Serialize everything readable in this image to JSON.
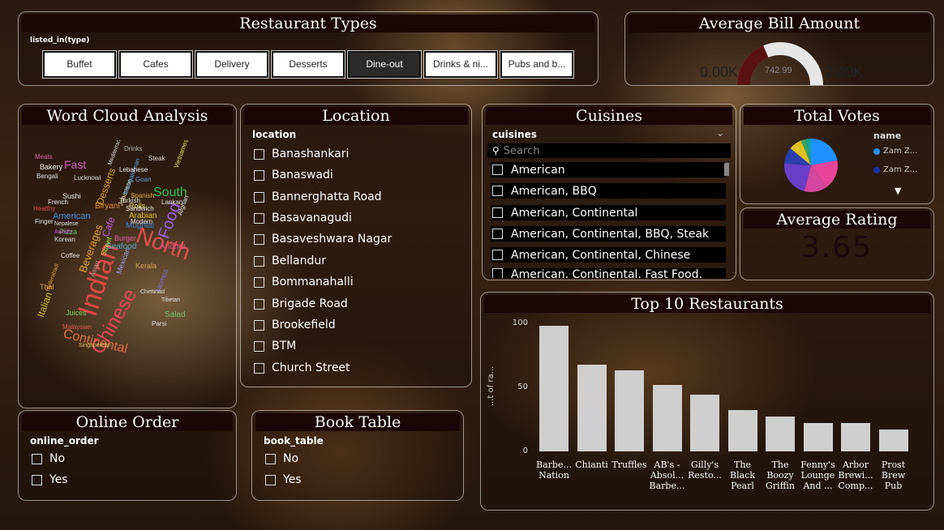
{
  "restaurant_types": {
    "title": "Restaurant Types",
    "slicer_label": "listed_in(type)",
    "options": [
      "Buffet",
      "Cafes",
      "Delivery",
      "Desserts",
      "Dine-out",
      "Drinks & ni...",
      "Pubs and b..."
    ],
    "selected": "Dine-out"
  },
  "avg_bill": {
    "title": "Average Bill Amount",
    "min_label": "0.00K",
    "max_label": "2.00K",
    "value_label": "742.99",
    "value": 742.99,
    "max": 2000
  },
  "word_cloud": {
    "title": "Word Cloud Analysis",
    "words": [
      "Indian",
      "North",
      "Chinese",
      "Continental",
      "Food",
      "South",
      "Desserts",
      "Fast",
      "Beverages",
      "Italian",
      "American",
      "Mughlai",
      "Biryani",
      "Cafe",
      "Arabian",
      "Seafood",
      "Street",
      "Burger",
      "Pizza",
      "Salad",
      "Kerala",
      "Mexican",
      "Andhra",
      "Sushi",
      "Bakery",
      "Rolls",
      "Momos",
      "Thai",
      "Japanese",
      "Asian",
      "Juices",
      "Malaysian",
      "Lucknowi",
      "Bengali",
      "Goan",
      "Mangalorean",
      "French",
      "Spanish",
      "Lebanese",
      "Sandwich",
      "Singaporean",
      "Korean",
      "Afghan",
      "Tibetan",
      "Lankan",
      "Parsi",
      "Awadhi",
      "Coffee",
      "Vietnamese",
      "Steak",
      "Turkish",
      "Mediterranean",
      "Drinks",
      "Meats",
      "Healthy",
      "Finger",
      "Hyderabadi",
      "Chettinad",
      "Modern",
      "Nepalese"
    ]
  },
  "location": {
    "title": "Location",
    "slicer_label": "location",
    "items": [
      "Banashankari",
      "Banaswadi",
      "Bannerghatta Road",
      "Basavanagudi",
      "Basaveshwara Nagar",
      "Bellandur",
      "Bommanahalli",
      "Brigade Road",
      "Brookefield",
      "BTM",
      "Church Street"
    ]
  },
  "cuisines": {
    "title": "Cuisines",
    "slicer_label": "cuisines",
    "search_placeholder": "Search",
    "items": [
      "American",
      "American, BBQ",
      "American, Continental",
      "American, Continental, BBQ, Steak",
      "American, Continental, Chinese",
      "American, Continental, Fast Food, Steak"
    ]
  },
  "total_votes": {
    "title": "Total Votes",
    "legend_title": "name",
    "legend_items": [
      {
        "label": "Zam Z...",
        "color": "#1e90ff"
      },
      {
        "label": "Zam Z...",
        "color": "#1a2fa8"
      }
    ],
    "slices": [
      {
        "value": 22,
        "color": "#1e90ff"
      },
      {
        "value": 18,
        "color": "#e8459a"
      },
      {
        "value": 14,
        "color": "#d4479e"
      },
      {
        "value": 22,
        "color": "#6a3fc8"
      },
      {
        "value": 10,
        "color": "#2b3fb0"
      },
      {
        "value": 8,
        "color": "#e0c020"
      },
      {
        "value": 3,
        "color": "#3aa060"
      },
      {
        "value": 3,
        "color": "#17a39a"
      }
    ]
  },
  "avg_rating": {
    "title": "Average Rating",
    "value": "3.65"
  },
  "online_order": {
    "title": "Online Order",
    "slicer_label": "online_order",
    "items": [
      "No",
      "Yes"
    ]
  },
  "book_table": {
    "title": "Book Table",
    "slicer_label": "book_table",
    "items": [
      "No",
      "Yes"
    ]
  },
  "chart_data": {
    "type": "bar",
    "title": "Top 10 Restaurants",
    "ylabel": "...t of ra...",
    "ylim": [
      0,
      100
    ],
    "yticks": [
      0,
      50,
      100
    ],
    "categories": [
      "Barbe... Nation",
      "Chianti",
      "Truffles",
      "AB's - Absol... Barbe...",
      "Gilly's Resto...",
      "The Black Pearl",
      "The Boozy Griffin",
      "Fenny's Lounge And ...",
      "Arbor Brewi... Comp...",
      "Prost Brew Pub"
    ],
    "values": [
      98,
      68,
      63,
      52,
      44,
      32,
      27,
      22,
      22,
      17
    ]
  }
}
